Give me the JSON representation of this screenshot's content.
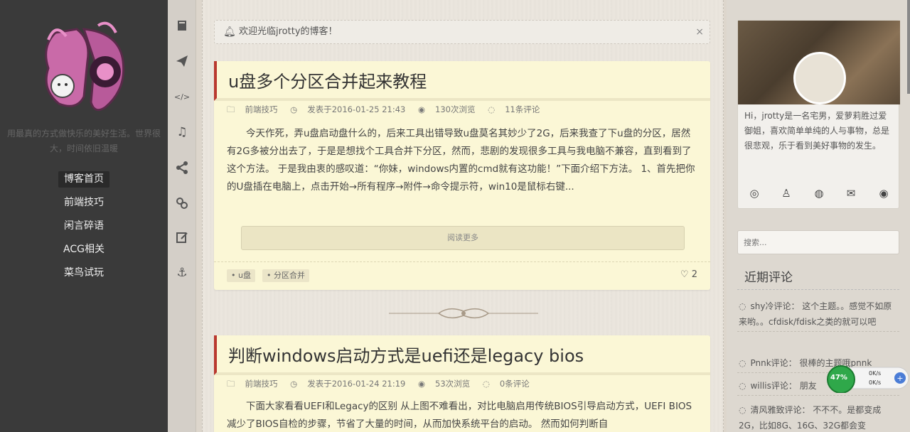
{
  "sidebar": {
    "tagline": "用最真的方式做快乐的美好生活。世界很大，时间依旧温暖",
    "nav": [
      {
        "label": "博客首页",
        "active": true
      },
      {
        "label": "前端技巧",
        "active": false
      },
      {
        "label": "闲言碎语",
        "active": false
      },
      {
        "label": "ACG相关",
        "active": false
      },
      {
        "label": "菜鸟试玩",
        "active": false
      }
    ]
  },
  "toolbar_icons": [
    "book-icon",
    "paper-plane-icon",
    "code-icon",
    "music-icon",
    "share-icon",
    "link-icon",
    "edit-icon",
    "anchor-icon"
  ],
  "notice": {
    "text": "欢迎光临jrotty的博客！",
    "close": "×"
  },
  "posts": [
    {
      "title": "u盘多个分区合并起来教程",
      "category": "前端技巧",
      "date": "发表于2016-01-25 21:43",
      "views": "130次浏览",
      "comments": "11条评论",
      "excerpt": "今天作死，弄u盘启动盘什么的，后来工具出错导致u盘莫名其妙少了2G，后来我查了下u盘的分区，居然有2G多被分出去了，于是是想找个工具合并下分区，然而，悲剧的发现很多工具与我电脑不兼容，直到看到了这个方法。      于是我由衷的感叹道：“你妹，windows内置的cmd就有这功能！”下面介绍下方法。 1、首先把你的U盘插在电脑上，点击开始→所有程序→附件→命令提示符，win10是鼠标右键...",
      "read_more": "阅读更多",
      "tags": [
        "u盘",
        "分区合并"
      ],
      "likes": "2"
    },
    {
      "title": "判断windows启动方式是uefi还是legacy bios",
      "category": "前端技巧",
      "date": "发表于2016-01-24 21:19",
      "views": "53次浏览",
      "comments": "0条评论",
      "excerpt": "下面大家看看UEFI和Legacy的区别       从上图不难看出，对比电脑启用传统BIOS引导启动方式，UEFI BIOS减少了BIOS自检的步骤，节省了大量的时间，从而加快系统平台的启动。 然而如何判断自"
    }
  ],
  "profile": {
    "bio": "Hi，jrotty是一名宅男，爱萝莉胜过爱御姐，喜欢简单单纯的人与事物，总是很悲观，乐于看到美好事物的发生。",
    "social": [
      "weibo-icon",
      "qq-icon",
      "wechat-icon",
      "mail-icon",
      "github-icon"
    ]
  },
  "search": {
    "placeholder": "搜索..."
  },
  "recent_comments": {
    "title": "近期评论",
    "items": [
      {
        "text": "shy冷评论： 这个主题。。感觉不如原来哟。。cfdisk/fdisk之类的就可以吧"
      },
      {
        "text": "Pnnk评论： 很棒的主题哦pnnk"
      },
      {
        "text": "willis评论： 朋友"
      },
      {
        "text": "清风雅致评论： 不不不。是都变成2G，比如8G、16G、32G都会变"
      }
    ]
  },
  "net_widget": {
    "percent": "47%",
    "up": "0K/s",
    "down": "0K/s"
  }
}
